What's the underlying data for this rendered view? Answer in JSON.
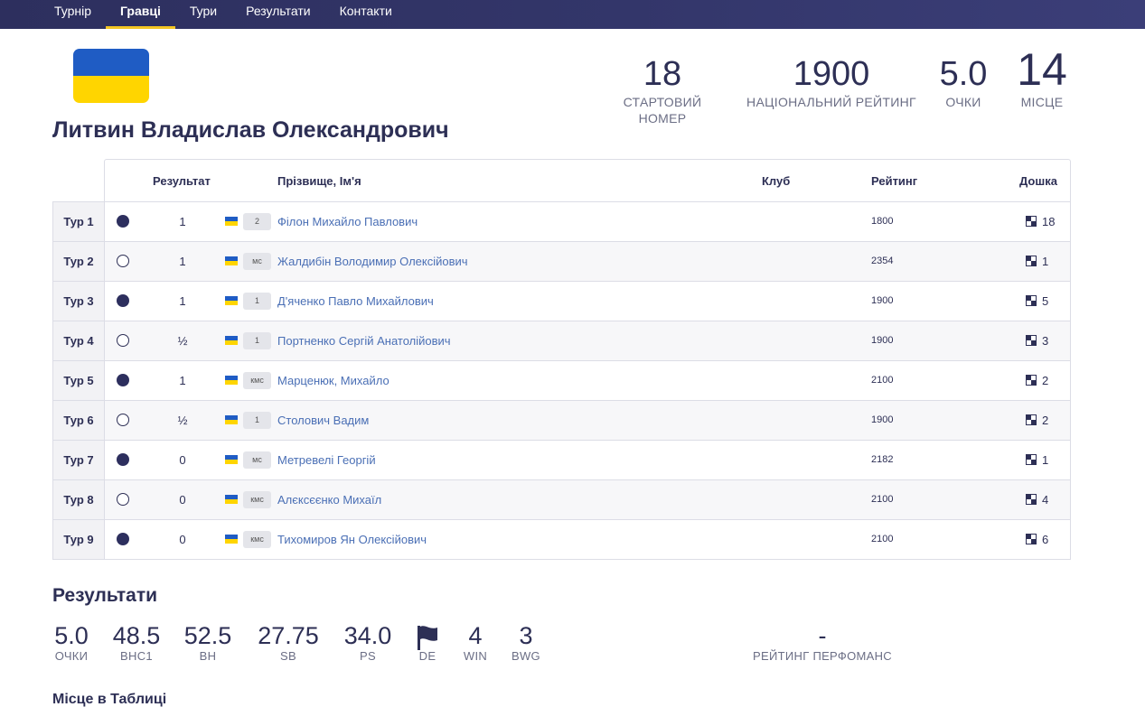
{
  "nav": {
    "items": [
      {
        "label": "Турнір",
        "active": false
      },
      {
        "label": "Гравці",
        "active": true
      },
      {
        "label": "Тури",
        "active": false
      },
      {
        "label": "Результати",
        "active": false
      },
      {
        "label": "Контакти",
        "active": false
      }
    ]
  },
  "player": {
    "name": "Литвин Владислав Олександрович",
    "flag_colors": [
      "#1f5cc4",
      "#ffd500"
    ],
    "stats": {
      "start_number": {
        "value": "18",
        "label": "СТАРТОВИЙ НОМЕР"
      },
      "national_rating": {
        "value": "1900",
        "label": "НАЦІОНАЛЬНИЙ РЕЙТИНГ"
      },
      "points": {
        "value": "5.0",
        "label": "ОЧКИ"
      },
      "place": {
        "value": "14",
        "label": "МІСЦЕ"
      }
    }
  },
  "table": {
    "headers": {
      "result": "Результат",
      "name": "Прізвище, Ім'я",
      "club": "Клуб",
      "rating": "Рейтинг",
      "board": "Дошка"
    },
    "rows": [
      {
        "round": "Тур 1",
        "color": "black",
        "result": "1",
        "title": "2",
        "opponent": "Філон Михайло Павлович",
        "rating": "1800",
        "board": "18"
      },
      {
        "round": "Тур 2",
        "color": "white",
        "result": "1",
        "title": "мс",
        "opponent": "Жалдибін Володимир Олексійович",
        "rating": "2354",
        "board": "1"
      },
      {
        "round": "Тур 3",
        "color": "black",
        "result": "1",
        "title": "1",
        "opponent": "Д'яченко Павло Михайлович",
        "rating": "1900",
        "board": "5"
      },
      {
        "round": "Тур 4",
        "color": "white",
        "result": "½",
        "title": "1",
        "opponent": "Портненко Сергій Анатолійович",
        "rating": "1900",
        "board": "3"
      },
      {
        "round": "Тур 5",
        "color": "black",
        "result": "1",
        "title": "кмс",
        "opponent": "Марценюк, Михайло",
        "rating": "2100",
        "board": "2"
      },
      {
        "round": "Тур 6",
        "color": "white",
        "result": "½",
        "title": "1",
        "opponent": "Столович Вадим",
        "rating": "1900",
        "board": "2"
      },
      {
        "round": "Тур 7",
        "color": "black",
        "result": "0",
        "title": "мс",
        "opponent": "Метревелі Георгій",
        "rating": "2182",
        "board": "1"
      },
      {
        "round": "Тур 8",
        "color": "white",
        "result": "0",
        "title": "кмс",
        "opponent": "Алєксєєнко Михаїл",
        "rating": "2100",
        "board": "4"
      },
      {
        "round": "Тур 9",
        "color": "black",
        "result": "0",
        "title": "кмс",
        "opponent": "Тихомиров Ян Олексійович",
        "rating": "2100",
        "board": "6"
      }
    ]
  },
  "results": {
    "title": "Результати",
    "stats": [
      {
        "value": "5.0",
        "label": "ОЧКИ"
      },
      {
        "value": "48.5",
        "label": "BHC1"
      },
      {
        "value": "52.5",
        "label": "BH"
      },
      {
        "value": "27.75",
        "label": "SB"
      },
      {
        "value": "34.0",
        "label": "PS"
      },
      {
        "value": "",
        "label": "DE",
        "icon": "flag-icon"
      },
      {
        "value": "4",
        "label": "WIN"
      },
      {
        "value": "3",
        "label": "BWG"
      }
    ],
    "performance": {
      "value": "-",
      "label": "РЕЙТИНГ ПЕРФОМАНС"
    }
  },
  "standings": {
    "title": "Місце в Таблиці"
  }
}
